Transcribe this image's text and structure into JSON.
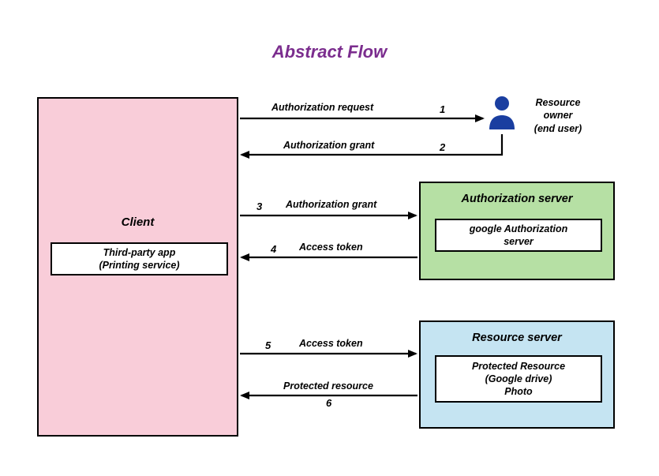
{
  "title": "Abstract Flow",
  "client": {
    "label": "Client",
    "sub_line1": "Third-party app",
    "sub_line2": "(Printing service)"
  },
  "auth_server": {
    "label": "Authorization server",
    "sub_line1": "google Authorization",
    "sub_line2": "server"
  },
  "resource_server": {
    "label": "Resource server",
    "sub_line1": "Protected Resource",
    "sub_line2": "(Google drive)",
    "sub_line3": "Photo"
  },
  "resource_owner": {
    "line1": "Resource",
    "line2": "owner",
    "line3": "(end user)"
  },
  "arrows": {
    "a1": {
      "label": "Authorization request",
      "num": "1"
    },
    "a2": {
      "label": "Authorization grant",
      "num": "2"
    },
    "a3": {
      "label": "Authorization grant",
      "num": "3"
    },
    "a4": {
      "label": "Access token",
      "num": "4"
    },
    "a5": {
      "label": "Access token",
      "num": "5"
    },
    "a6": {
      "label": "Protected resource",
      "num": "6"
    }
  }
}
